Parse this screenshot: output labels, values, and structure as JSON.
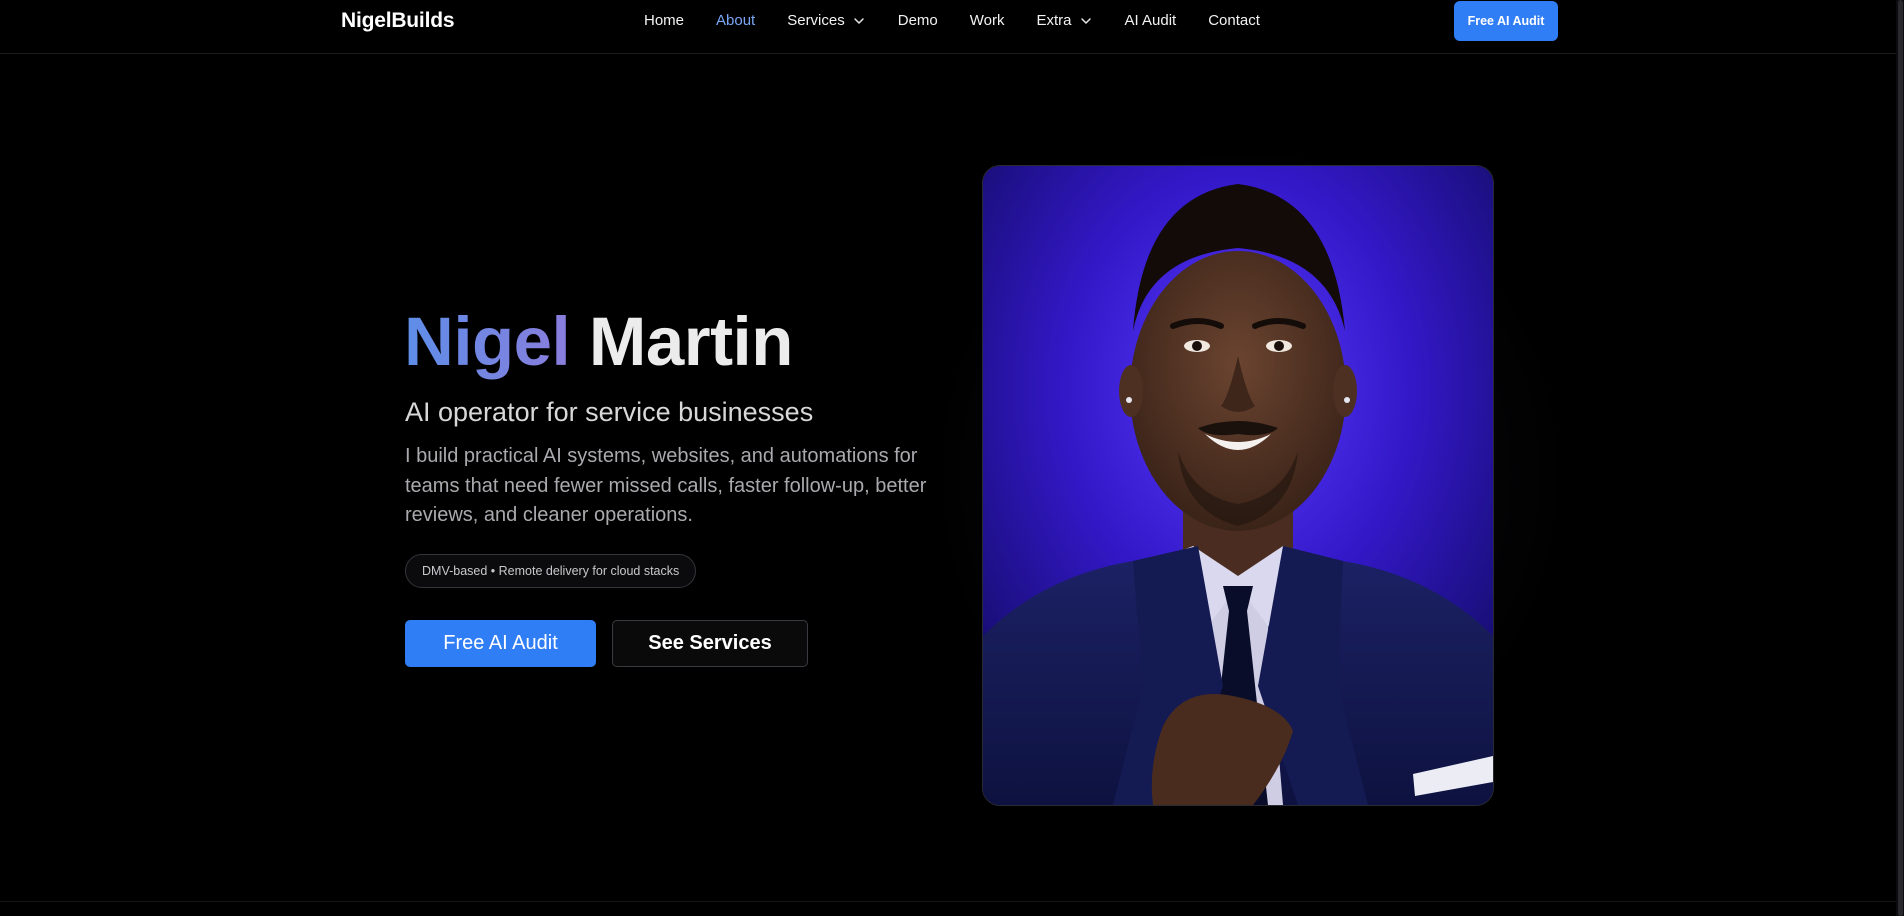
{
  "nav": {
    "brand": "NigelBuilds",
    "links": [
      {
        "label": "Home"
      },
      {
        "label": "About"
      },
      {
        "label": "Services"
      },
      {
        "label": "Demo"
      },
      {
        "label": "Work"
      },
      {
        "label": "Extra"
      },
      {
        "label": "AI Audit"
      },
      {
        "label": "Contact"
      }
    ],
    "active": "About",
    "cta_label": "Free AI Audit"
  },
  "hero": {
    "first_name": "Nigel",
    "last_name": "Martin",
    "subtitle": "AI operator for service businesses",
    "description": "I build practical AI systems, websites, and automations for teams that need fewer missed calls, faster follow-up, better reviews, and cleaner operations.",
    "location_pill": "DMV-based • Remote delivery for cloud stacks",
    "primary_cta": "Free AI Audit",
    "secondary_cta": "See Services"
  },
  "colors": {
    "accent_blue": "#2f7ef6",
    "active_link": "#7aa7f5",
    "name_gradient_start": "#5d8ee8",
    "name_gradient_end": "#8a7ddc",
    "portrait_bg": "#3a1fd0"
  },
  "icons": {
    "dropdown": "chevron-down-icon"
  }
}
